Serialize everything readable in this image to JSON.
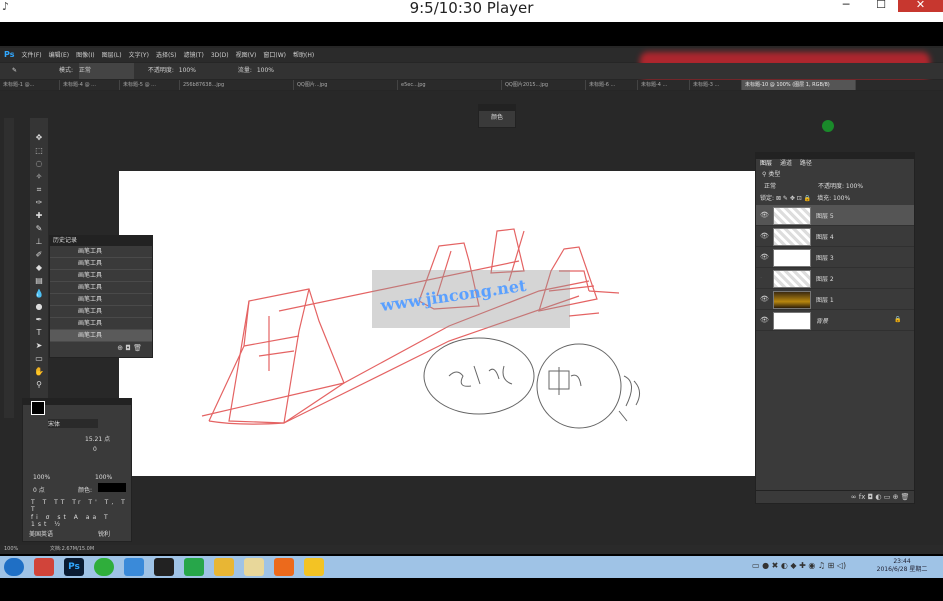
{
  "player": {
    "title": "9:5/10:30 Player",
    "minimize": "─",
    "maximize": "☐",
    "close": "✕"
  },
  "ps": {
    "logo": "Ps",
    "menus": [
      "文件(F)",
      "编辑(E)",
      "图像(I)",
      "图层(L)",
      "文字(Y)",
      "选择(S)",
      "滤镜(T)",
      "3D(D)",
      "视图(V)",
      "窗口(W)",
      "帮助(H)"
    ],
    "options": {
      "mode_label": "模式:",
      "mode_value": "正常",
      "opacity_label": "不透明度:",
      "opacity_value": "100%",
      "flow_label": "流量:",
      "flow_value": "100%"
    },
    "tabs": [
      "未标题-1 @...",
      "未标题-4 @ ...",
      "未标题-5 @ ...",
      "256b87638...jpg",
      "QQ图片...jpg",
      "e5ec...jpg",
      "QQ图片2015...jpg",
      "未标题-6 ...",
      "未标题-4 ...",
      "未标题-3 ...",
      "未标题-10 @ 100% (图层 1, RGB/8)"
    ],
    "mini_panel_label": "颜色",
    "history": {
      "title": "历史记录",
      "items": [
        "画笔工具",
        "画笔工具",
        "画笔工具",
        "画笔工具",
        "画笔工具",
        "画笔工具",
        "画笔工具",
        "画笔工具"
      ]
    },
    "char_panel": {
      "font": "宋体",
      "size": "15.21 点",
      "tracking": "0",
      "scale_v": "100%",
      "scale_h": "100%",
      "baseline": "0 点",
      "color_label": "颜色:",
      "lang": "美国英语",
      "aa": "锐利"
    },
    "layers": {
      "tabs": [
        "图层",
        "通道",
        "路径"
      ],
      "kind": "类型",
      "blend": "正常",
      "opacity_label": "不透明度:",
      "opacity_value": "100%",
      "lock_label": "锁定:",
      "fill_label": "填充:",
      "fill_value": "100%",
      "items": [
        {
          "name": "图层 5",
          "thumb": "transparent"
        },
        {
          "name": "图层 4",
          "thumb": "transparent"
        },
        {
          "name": "图层 3",
          "thumb": "white"
        },
        {
          "name": "图层 2",
          "thumb": "transparent"
        },
        {
          "name": "图层 1",
          "thumb": "photo"
        },
        {
          "name": "背景",
          "thumb": "white"
        }
      ]
    },
    "status": {
      "zoom": "100%",
      "doc": "文档:2.67M/15.0M"
    },
    "watermark": "www.jincong.net"
  },
  "taskbar": {
    "time": "23:44",
    "date": "2016/6/28 星期二"
  },
  "colors": {
    "sketch_red": "#e04848",
    "sketch_gray": "#666666",
    "accent_blue": "#31a8ff"
  }
}
